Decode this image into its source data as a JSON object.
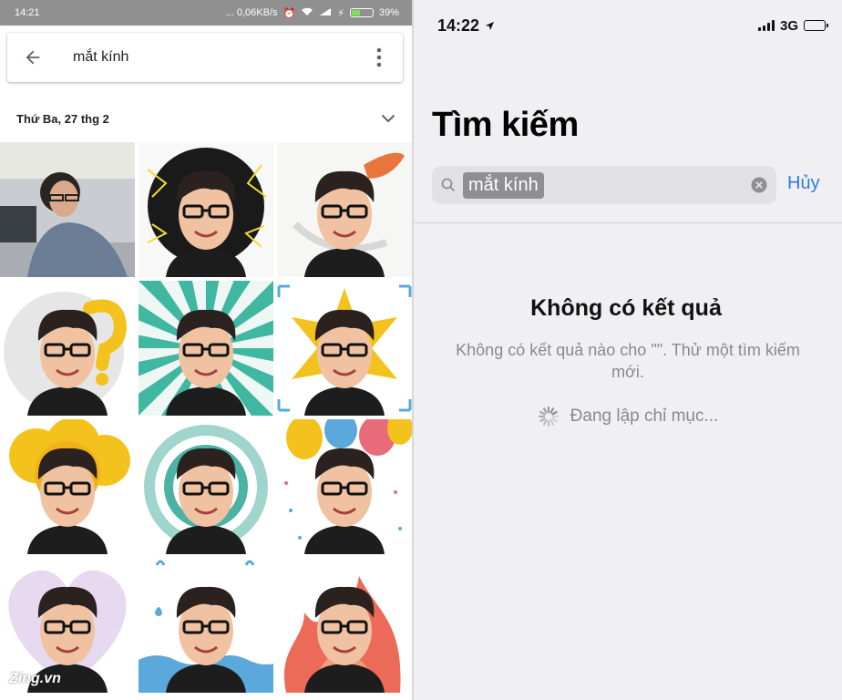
{
  "android": {
    "status": {
      "time": "14:21",
      "right_text": "... 0,06KB/s",
      "battery": "39%",
      "battery_level": 0.39
    },
    "search": {
      "query": "mắt kính"
    },
    "date_section": {
      "label": "Thứ Ba, 27 thg 2"
    },
    "watermark": "Zing.vn",
    "photos": [
      {
        "kind": "photo-office"
      },
      {
        "kind": "sticker-scared"
      },
      {
        "kind": "sticker-leaf"
      },
      {
        "kind": "sticker-question"
      },
      {
        "kind": "sticker-sunburst"
      },
      {
        "kind": "sticker-star"
      },
      {
        "kind": "sticker-cloud"
      },
      {
        "kind": "sticker-spiral"
      },
      {
        "kind": "sticker-balloons"
      },
      {
        "kind": "sticker-heart"
      },
      {
        "kind": "sticker-water"
      },
      {
        "kind": "sticker-fire"
      }
    ]
  },
  "ios": {
    "status": {
      "time": "14:22",
      "network": "3G"
    },
    "title": "Tìm kiếm",
    "search": {
      "query": "mắt kính"
    },
    "cancel_label": "Hủy",
    "no_results_title": "Không có kết quả",
    "no_results_desc": "Không có kết quả nào cho \"\". Thử một tìm kiếm mới.",
    "indexing_label": "Đang lập chỉ mục..."
  },
  "colors": {
    "android_status_bar": "#909090",
    "ios_accent": "#2f7be0",
    "ios_background": "#f0f0f2"
  }
}
